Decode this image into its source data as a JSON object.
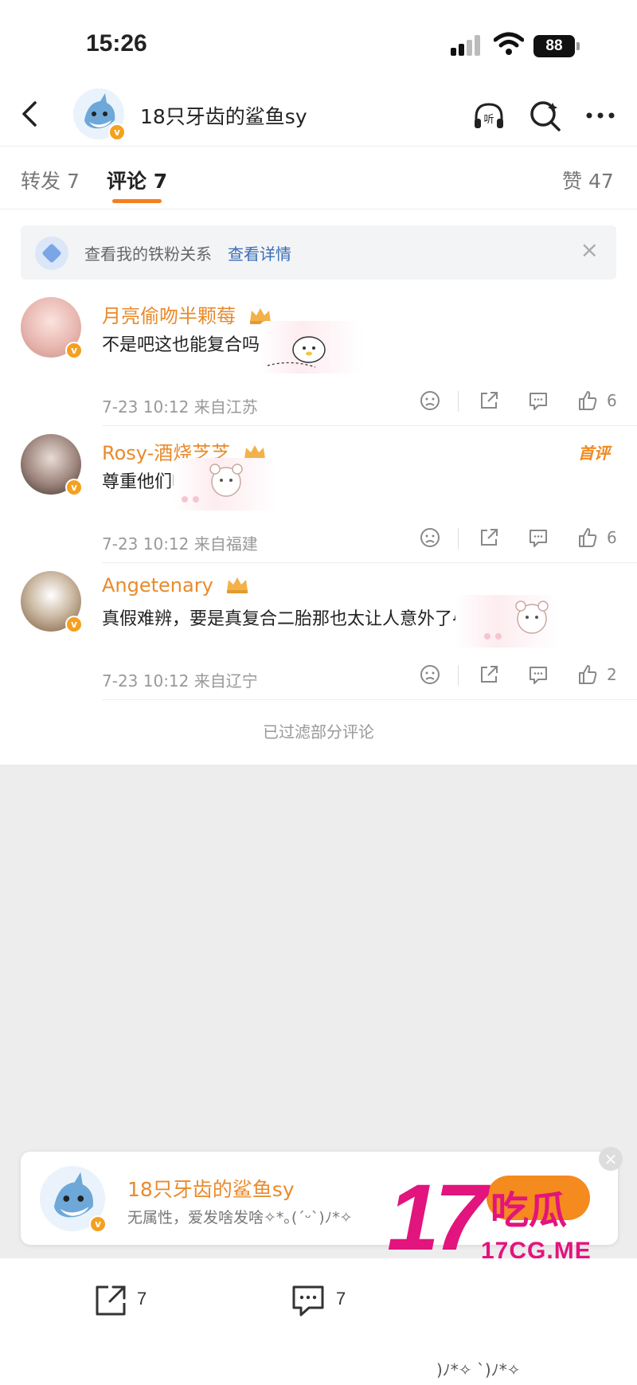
{
  "status_bar": {
    "time": "15:26",
    "battery": "88"
  },
  "nav": {
    "back": "‹",
    "title": "18只牙齿的鲨鱼sy"
  },
  "tabs": {
    "repost": "转发 7",
    "comment": "评论 7",
    "like": "赞 47"
  },
  "fan_banner": {
    "text": "查看我的铁粉关系",
    "link": "查看详情",
    "close": "×"
  },
  "comments": [
    {
      "name": "月亮偷吻半颗莓",
      "text": "不是吧这也能复合吗",
      "meta": "7-23 10:12  来自江苏",
      "likes": "6",
      "avatar_color": "#f3c9c9"
    },
    {
      "name": "Rosy-酒烧芝芝",
      "text": "尊重他们吧",
      "meta": "7-23 10:12  来自福建",
      "likes": "6",
      "tag": "首评",
      "avatar_color": "#6b5a55"
    },
    {
      "name": "Angetenary",
      "text": "真假难辨，要是真复合二胎那也太让人意外了😭",
      "meta": "7-23 10:12  来自辽宁",
      "likes": "2",
      "avatar_color": "#b9a68f"
    }
  ],
  "filtered_notice": "已过滤部分评论",
  "follow_card": {
    "name": "18只牙齿的鲨鱼sy",
    "desc": "无属性，爱发啥发啥✧*｡(ˊᵕˋ)ﾉ*✧",
    "close": "×"
  },
  "watermark": {
    "big": "17",
    "cn": "吃瓜",
    "url": "17CG.ME"
  },
  "bottom_bar": {
    "repost_count": "7",
    "comment_count": "7",
    "stray_text": ")ﾉ*✧   ˋ)ﾉ*✧"
  },
  "colors": {
    "accent": "#f57f1f",
    "name": "#e98a2b",
    "link": "#3a6cb8",
    "watermark": "#e2147d"
  }
}
